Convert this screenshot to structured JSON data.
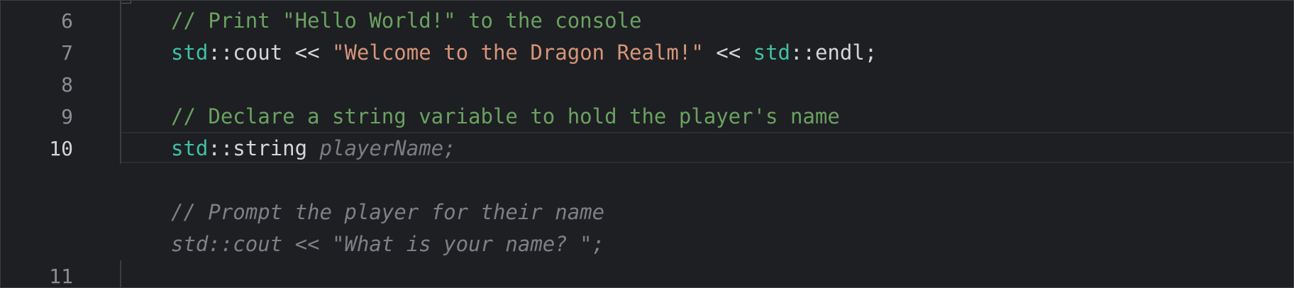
{
  "editor": {
    "lines": [
      {
        "number": "6",
        "tokens": [
          {
            "text": "// Print \"Hello World!\" to the console",
            "kind": "comment"
          }
        ]
      },
      {
        "number": "7",
        "tokens": [
          {
            "text": "std",
            "kind": "ns"
          },
          {
            "text": "::cout << ",
            "kind": "plain"
          },
          {
            "text": "\"Welcome to the Dragon Realm!\"",
            "kind": "string"
          },
          {
            "text": " << ",
            "kind": "plain"
          },
          {
            "text": "std",
            "kind": "ns"
          },
          {
            "text": "::endl;",
            "kind": "plain"
          }
        ]
      },
      {
        "number": "8",
        "tokens": []
      },
      {
        "number": "9",
        "tokens": [
          {
            "text": "// Declare a string variable to hold the player's name",
            "kind": "comment"
          }
        ]
      },
      {
        "number": "10",
        "tokens": [
          {
            "text": "std",
            "kind": "ns"
          },
          {
            "text": "::string ",
            "kind": "plain"
          },
          {
            "text": "playerName;",
            "kind": "hint"
          }
        ]
      },
      {
        "number": "",
        "tokens": []
      },
      {
        "number": "",
        "tokens": [
          {
            "text": "// Prompt the player for their name",
            "kind": "ghost"
          }
        ]
      },
      {
        "number": "",
        "tokens": [
          {
            "text": "std::cout << \"What is your name? \";",
            "kind": "ghost"
          }
        ]
      },
      {
        "number": "11",
        "tokens": []
      }
    ],
    "active_line": "10"
  },
  "colors": {
    "background": "#1e1f22",
    "comment": "#6aa162",
    "namespace": "#3fc1a6",
    "plain": "#d4d6da",
    "string": "#d6957a",
    "ghost_suggestion": "#7d8086"
  }
}
